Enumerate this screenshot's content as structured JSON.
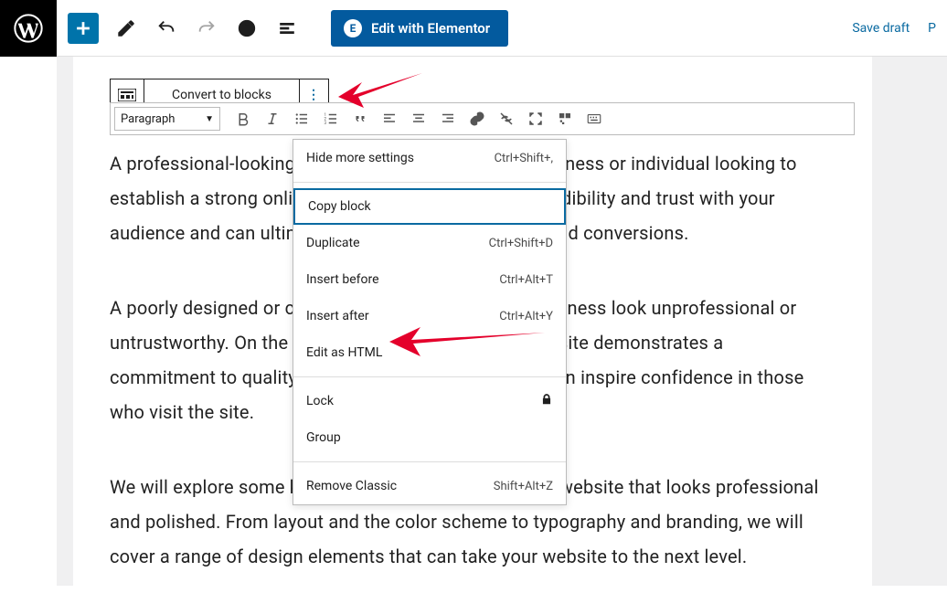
{
  "topbar": {
    "elementor_label": "Edit with Elementor",
    "save_draft_label": "Save draft",
    "right_crop": "P"
  },
  "block_toolbar": {
    "convert_label": "Convert to blocks"
  },
  "format_bar": {
    "paragraph_label": "Paragraph"
  },
  "dropdown": {
    "hide_more": {
      "label": "Hide more settings",
      "kbd": "Ctrl+Shift+,"
    },
    "copy_block": {
      "label": "Copy block",
      "kbd": ""
    },
    "duplicate": {
      "label": "Duplicate",
      "kbd": "Ctrl+Shift+D"
    },
    "insert_before": {
      "label": "Insert before",
      "kbd": "Ctrl+Alt+T"
    },
    "insert_after": {
      "label": "Insert after",
      "kbd": "Ctrl+Alt+Y"
    },
    "edit_html": {
      "label": "Edit as HTML",
      "kbd": ""
    },
    "lock": {
      "label": "Lock",
      "kbd": ""
    },
    "group": {
      "label": "Group",
      "kbd": ""
    },
    "remove_classic": {
      "label": "Remove Classic",
      "kbd": "Shift+Alt+Z"
    }
  },
  "article": {
    "p1": "A professional-looking website is essential for any business or individual looking to establish a strong online presence. It helps to build credibility and trust with your audience and can ultimately lead to increased traffic and conversions.",
    "p2": "A poorly designed or cluttered website can make a business look unprofessional or untrustworthy. On the other hand, a well-designed website demonstrates a commitment to quality and attention to detail, which can inspire confidence in those who visit the site.",
    "p3": "We will explore some key tips and tricks for creating a website that looks professional and polished. From layout and the color scheme to typography and branding, we will cover a range of design elements that can take your website to the next level."
  }
}
